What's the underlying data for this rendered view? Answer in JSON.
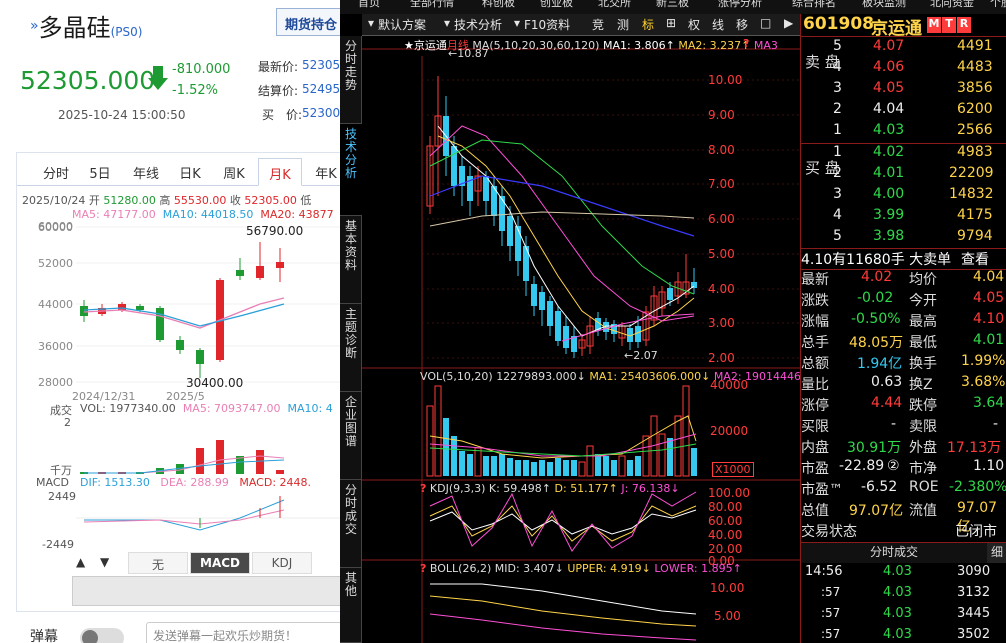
{
  "left": {
    "title": "多晶硅",
    "title_code": "(PS0)",
    "header_button": "期货持仓",
    "price": "52305.000",
    "change": "-810.000",
    "change_pct": "-1.52%",
    "datetime": "2025-10-24 15:00:50",
    "latest_label": "最新价:",
    "latest_value": "52305",
    "settle_label": "结算价:",
    "settle_value": "52495",
    "buy_label": "买　价:",
    "buy_value": "52300",
    "tabs": [
      "分时",
      "5日",
      "年线",
      "日K",
      "周K",
      "月K",
      "年K"
    ],
    "active_tab": "月K",
    "info_date": "2025/10/24",
    "info_open_label": "开",
    "info_open": "51280.00",
    "info_high_label": "高",
    "info_high": "55530.00",
    "info_close_label": "收",
    "info_close": "52305.00",
    "info_low_label": "低",
    "ma5": "MA5: 47177.00",
    "ma10": "MA10: 44018.50",
    "ma20": "MA20: 43877",
    "y_ticks": [
      "60000",
      "52000",
      "44000",
      "36000",
      "28000"
    ],
    "high_mark": "56790.00",
    "low_mark": "30400.00",
    "date_a": "2024/12/31",
    "date_b": "2025/5",
    "vol_label": "成交",
    "vol_text": "VOL: 1977340.00",
    "vol_ma5": "MA5: 7093747.00",
    "vol_ma10": "MA10: 4",
    "vol_tick": "2",
    "vol_unit": "千万",
    "macd_label": "MACD",
    "dif": "DIF: 1513.30",
    "dea": "DEA: 288.99",
    "macd_val": "MACD: 2448.",
    "macd_top": "2449",
    "macd_bot": "-2449",
    "sub_tabs": [
      "无",
      "MACD",
      "KDJ"
    ],
    "danmu_label": "弹幕",
    "danmu_placeholder": "发送弹幕一起欢乐炒期货！"
  },
  "right": {
    "top_menu": [
      "首页",
      "全部行情",
      "科创板",
      "创业板",
      "北交所",
      "新三板",
      "涨停分析",
      "综合排名",
      "板块监测",
      "北向资金",
      "个股"
    ],
    "sidebar_tabs": [
      "分时走势",
      "技术分析",
      "基本资料",
      "主题诊断",
      "企业图谱",
      "分时成交",
      "其他"
    ],
    "toolbar": [
      "默认方案",
      "技术分析",
      "F10资料",
      "竞",
      "测",
      "标",
      "⊞",
      "权",
      "线",
      "移",
      "□",
      "▶"
    ],
    "stock_code": "601908",
    "stock_name": "京运通",
    "badges": [
      "M",
      "T",
      "R"
    ],
    "main_caption": "京运通",
    "main_period": "月线",
    "ma_line": "MA(5,10,20,30,60,120)",
    "ma1": "MA1: 3.806↑",
    "ma2": "MA2: 3.237↑",
    "ma3": "MA3",
    "price_ticks": [
      "10.00",
      "9.00",
      "8.00",
      "7.00",
      "6.00",
      "5.00",
      "4.00",
      "3.00",
      "2.00"
    ],
    "high_label": "10.87",
    "low_label": "2.07",
    "vol_caption": "VOL(5,10,20)",
    "vol_value": "12279893.000↓",
    "vol_ma1": "MA1: 25403606.000↓",
    "vol_ma2": "MA2: 19014446.00",
    "vol_ticks": [
      "40000",
      "20000"
    ],
    "vol_unit": "X1000",
    "kdj_caption": "KDJ(9,3,3)",
    "kdj_k": "K: 59.498↑",
    "kdj_d": "D: 51.177↑",
    "kdj_j": "J: 76.138↓",
    "kdj_ticks": [
      "100.00",
      "80.00",
      "60.00",
      "40.00",
      "20.00",
      "0.00"
    ],
    "boll_caption": "BOLL(26,2)",
    "boll_mid": "MID: 3.407↓",
    "boll_up": "UPPER: 4.919↓",
    "boll_low": "LOWER: 1.895↑",
    "boll_ticks": [
      "10.00",
      "5.00"
    ],
    "sell_label": "卖 盘",
    "buy_label": "买 盘",
    "asks": [
      {
        "lvl": "5",
        "p": "4.07",
        "v": "4491"
      },
      {
        "lvl": "4",
        "p": "4.06",
        "v": "4483"
      },
      {
        "lvl": "3",
        "p": "4.05",
        "v": "3856"
      },
      {
        "lvl": "2",
        "p": "4.04",
        "v": "6200"
      },
      {
        "lvl": "1",
        "p": "4.03",
        "v": "2566"
      }
    ],
    "bids": [
      {
        "lvl": "1",
        "p": "4.02",
        "v": "4983"
      },
      {
        "lvl": "2",
        "p": "4.01",
        "v": "22209"
      },
      {
        "lvl": "3",
        "p": "4.00",
        "v": "14832"
      },
      {
        "lvl": "4",
        "p": "3.99",
        "v": "4175"
      },
      {
        "lvl": "5",
        "p": "3.98",
        "v": "9794"
      }
    ],
    "big_order": "4.10有11680手 大卖单",
    "view_btn": "查看",
    "stats": [
      [
        "最新",
        "4.02",
        "均价",
        "4.04"
      ],
      [
        "涨跌",
        "-0.02",
        "今开",
        "4.05"
      ],
      [
        "涨幅",
        "-0.50%",
        "最高",
        "4.10"
      ],
      [
        "总手",
        "48.05万",
        "最低",
        "4.01"
      ],
      [
        "总额",
        "1.94亿",
        "换手",
        "1.99%"
      ],
      [
        "量比",
        "0.63",
        "换Z",
        "3.68%"
      ],
      [
        "涨停",
        "4.44",
        "跌停",
        "3.64"
      ],
      [
        "买限",
        "-",
        "卖限",
        "-"
      ],
      [
        "内盘",
        "30.91万",
        "外盘",
        "17.13万"
      ],
      [
        "市盈",
        "-22.89",
        "市净",
        "1.10"
      ],
      [
        "市盈™",
        "-6.52",
        "ROE",
        "-2.380%"
      ],
      [
        "总值",
        "97.07亿",
        "流值",
        "97.07亿"
      ],
      [
        "交易状态",
        "",
        "",
        "已闭市"
      ]
    ],
    "pe_badge": "②",
    "trades_title": "分时成交",
    "trades_btn": "细",
    "trades": [
      {
        "t": "14:56",
        "p": "4.03",
        "v": "3090"
      },
      {
        "t": ":57",
        "p": "4.03",
        "v": "3132"
      },
      {
        "t": ":57",
        "p": "4.03",
        "v": "3445"
      },
      {
        "t": ":57",
        "p": "4.03",
        "v": "3502"
      }
    ]
  }
}
